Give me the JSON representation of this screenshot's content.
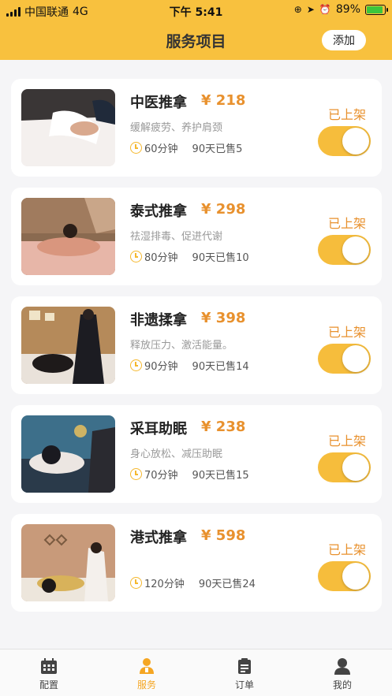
{
  "status_bar": {
    "carrier": "中国联通",
    "network": "4G",
    "time": "下午 5:41",
    "battery": "89%"
  },
  "header": {
    "title": "服务项目",
    "add_label": "添加",
    "bg_color": "#f8c13e"
  },
  "services": [
    {
      "name": "中医推拿",
      "price": "¥ 218",
      "desc": "缓解疲劳、养护肩颈",
      "duration": "60分钟",
      "sold": "90天已售5",
      "status": "已上架",
      "on": true
    },
    {
      "name": "泰式推拿",
      "price": "¥ 298",
      "desc": "祛湿排毒、促进代谢",
      "duration": "80分钟",
      "sold": "90天已售10",
      "status": "已上架",
      "on": true
    },
    {
      "name": "非遗揉拿",
      "price": "¥ 398",
      "desc": "释放压力、激活能量。",
      "duration": "90分钟",
      "sold": "90天已售14",
      "status": "已上架",
      "on": true
    },
    {
      "name": "采耳助眠",
      "price": "¥ 238",
      "desc": "身心放松、减压助眠",
      "duration": "70分钟",
      "sold": "90天已售15",
      "status": "已上架",
      "on": true
    },
    {
      "name": "港式推拿",
      "price": "¥ 598",
      "desc": "",
      "duration": "120分钟",
      "sold": "90天已售24",
      "status": "已上架",
      "on": true
    }
  ],
  "tabbar": {
    "items": [
      {
        "label": "配置",
        "icon": "calendar-icon",
        "active": false
      },
      {
        "label": "服务",
        "icon": "staff-icon",
        "active": true
      },
      {
        "label": "订单",
        "icon": "clipboard-icon",
        "active": false
      },
      {
        "label": "我的",
        "icon": "user-icon",
        "active": false
      }
    ],
    "active_color": "#f5a623"
  }
}
